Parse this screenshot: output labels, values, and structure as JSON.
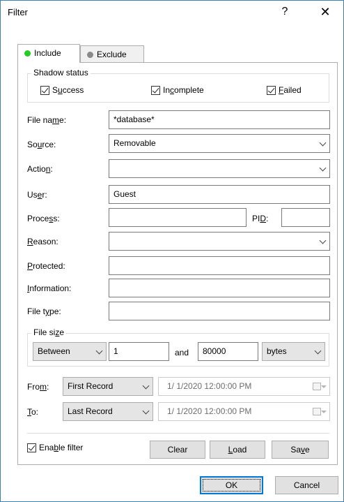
{
  "window": {
    "title": "Filter",
    "help": "?",
    "close": "✕"
  },
  "tabs": [
    {
      "label": "Include",
      "active": true,
      "icon_color": "#22cc22"
    },
    {
      "label": "Exclude",
      "active": false,
      "icon_color": "#888888"
    }
  ],
  "shadow_status": {
    "title": "Shadow status",
    "items": [
      {
        "pre": "S",
        "ul": "u",
        "post": "ccess",
        "checked": true
      },
      {
        "pre": "In",
        "ul": "c",
        "post": "omplete",
        "checked": true
      },
      {
        "pre": "",
        "ul": "F",
        "post": "ailed",
        "checked": true
      }
    ]
  },
  "fields": {
    "file_name": {
      "pre": "File na",
      "ul": "m",
      "post": "e:",
      "value": "*database*"
    },
    "source": {
      "pre": "So",
      "ul": "u",
      "post": "rce:",
      "value": "Removable"
    },
    "action": {
      "pre": "Actio",
      "ul": "n",
      "post": ":",
      "value": ""
    },
    "user": {
      "pre": "Us",
      "ul": "e",
      "post": "r:",
      "value": "Guest"
    },
    "process": {
      "pre": "Proce",
      "ul": "s",
      "post": "s:",
      "value": ""
    },
    "pid": {
      "pre": "PI",
      "ul": "D",
      "post": ":",
      "value": ""
    },
    "reason": {
      "pre": "",
      "ul": "R",
      "post": "eason:",
      "value": ""
    },
    "protected": {
      "pre": "",
      "ul": "P",
      "post": "rotected:",
      "value": ""
    },
    "information": {
      "pre": "",
      "ul": "I",
      "post": "nformation:",
      "value": ""
    },
    "file_type": {
      "pre": "File t",
      "ul": "y",
      "post": "pe:",
      "value": ""
    }
  },
  "file_size": {
    "title_pre": "File si",
    "title_ul": "z",
    "title_post": "e",
    "mode": "Between",
    "min": "1",
    "and_label": "and",
    "max": "80000",
    "unit": "bytes"
  },
  "from": {
    "pre": "Fro",
    "ul": "m",
    "post": ":",
    "selection": "First Record",
    "date": "1/  1/2020 12:00:00 PM"
  },
  "to": {
    "pre": "",
    "ul": "T",
    "post": "o:",
    "selection": "Last Record",
    "date": "1/  1/2020 12:00:00 PM"
  },
  "enable_filter": {
    "pre": "Ena",
    "ul": "b",
    "post": "le filter",
    "checked": true
  },
  "buttons": {
    "clear": "Clear",
    "load_ul": "L",
    "load_post": "oad",
    "save_pre": "Sa",
    "save_ul": "v",
    "save_post": "e",
    "ok": "OK",
    "cancel": "Cancel"
  }
}
